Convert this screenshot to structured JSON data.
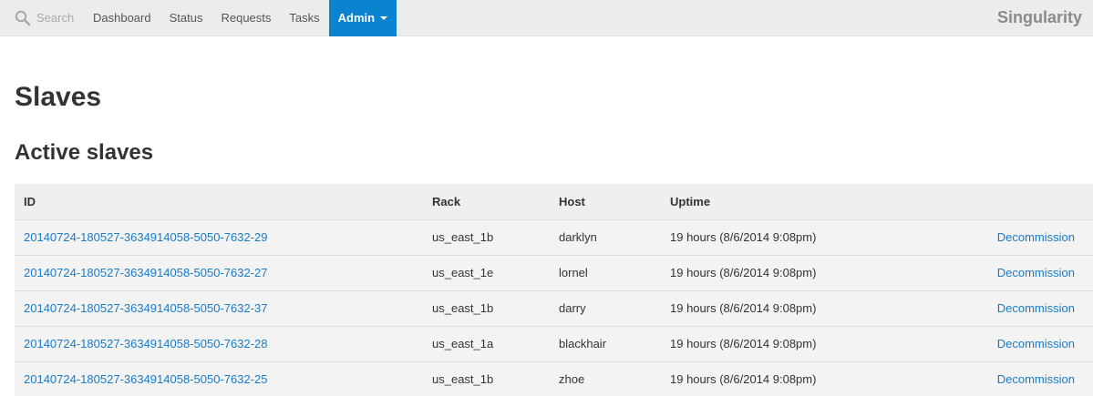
{
  "nav": {
    "search_label": "Search",
    "items": [
      "Dashboard",
      "Status",
      "Requests",
      "Tasks"
    ],
    "active_label": "Admin",
    "brand": "Singularity"
  },
  "page": {
    "title": "Slaves",
    "section_title": "Active slaves"
  },
  "table": {
    "headers": {
      "id": "ID",
      "rack": "Rack",
      "host": "Host",
      "uptime": "Uptime"
    },
    "rows": [
      {
        "id": "20140724-180527-3634914058-5050-7632-29",
        "rack": "us_east_1b",
        "host": "darklyn",
        "uptime": "19 hours (8/6/2014 9:08pm)",
        "action": "Decommission"
      },
      {
        "id": "20140724-180527-3634914058-5050-7632-27",
        "rack": "us_east_1e",
        "host": "lornel",
        "uptime": "19 hours (8/6/2014 9:08pm)",
        "action": "Decommission"
      },
      {
        "id": "20140724-180527-3634914058-5050-7632-37",
        "rack": "us_east_1b",
        "host": "darry",
        "uptime": "19 hours (8/6/2014 9:08pm)",
        "action": "Decommission"
      },
      {
        "id": "20140724-180527-3634914058-5050-7632-28",
        "rack": "us_east_1a",
        "host": "blackhair",
        "uptime": "19 hours (8/6/2014 9:08pm)",
        "action": "Decommission"
      },
      {
        "id": "20140724-180527-3634914058-5050-7632-25",
        "rack": "us_east_1b",
        "host": "zhoe",
        "uptime": "19 hours (8/6/2014 9:08pm)",
        "action": "Decommission"
      }
    ]
  },
  "colors": {
    "accent": "#0a84d0",
    "link": "#1a7bc7",
    "navbar_bg": "#ececec"
  },
  "icons": {
    "search": "search-icon",
    "dropdown": "caret-down-icon"
  }
}
